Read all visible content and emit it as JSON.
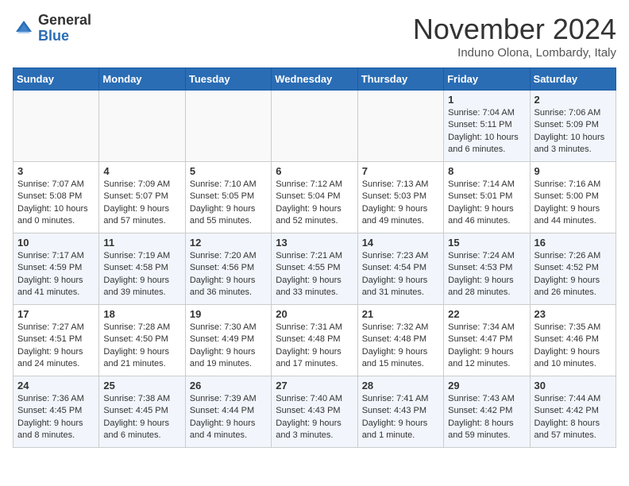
{
  "header": {
    "logo_general": "General",
    "logo_blue": "Blue",
    "month_title": "November 2024",
    "location": "Induno Olona, Lombardy, Italy"
  },
  "weekdays": [
    "Sunday",
    "Monday",
    "Tuesday",
    "Wednesday",
    "Thursday",
    "Friday",
    "Saturday"
  ],
  "weeks": [
    [
      {
        "day": "",
        "content": ""
      },
      {
        "day": "",
        "content": ""
      },
      {
        "day": "",
        "content": ""
      },
      {
        "day": "",
        "content": ""
      },
      {
        "day": "",
        "content": ""
      },
      {
        "day": "1",
        "content": "Sunrise: 7:04 AM\nSunset: 5:11 PM\nDaylight: 10 hours and 6 minutes."
      },
      {
        "day": "2",
        "content": "Sunrise: 7:06 AM\nSunset: 5:09 PM\nDaylight: 10 hours and 3 minutes."
      }
    ],
    [
      {
        "day": "3",
        "content": "Sunrise: 7:07 AM\nSunset: 5:08 PM\nDaylight: 10 hours and 0 minutes."
      },
      {
        "day": "4",
        "content": "Sunrise: 7:09 AM\nSunset: 5:07 PM\nDaylight: 9 hours and 57 minutes."
      },
      {
        "day": "5",
        "content": "Sunrise: 7:10 AM\nSunset: 5:05 PM\nDaylight: 9 hours and 55 minutes."
      },
      {
        "day": "6",
        "content": "Sunrise: 7:12 AM\nSunset: 5:04 PM\nDaylight: 9 hours and 52 minutes."
      },
      {
        "day": "7",
        "content": "Sunrise: 7:13 AM\nSunset: 5:03 PM\nDaylight: 9 hours and 49 minutes."
      },
      {
        "day": "8",
        "content": "Sunrise: 7:14 AM\nSunset: 5:01 PM\nDaylight: 9 hours and 46 minutes."
      },
      {
        "day": "9",
        "content": "Sunrise: 7:16 AM\nSunset: 5:00 PM\nDaylight: 9 hours and 44 minutes."
      }
    ],
    [
      {
        "day": "10",
        "content": "Sunrise: 7:17 AM\nSunset: 4:59 PM\nDaylight: 9 hours and 41 minutes."
      },
      {
        "day": "11",
        "content": "Sunrise: 7:19 AM\nSunset: 4:58 PM\nDaylight: 9 hours and 39 minutes."
      },
      {
        "day": "12",
        "content": "Sunrise: 7:20 AM\nSunset: 4:56 PM\nDaylight: 9 hours and 36 minutes."
      },
      {
        "day": "13",
        "content": "Sunrise: 7:21 AM\nSunset: 4:55 PM\nDaylight: 9 hours and 33 minutes."
      },
      {
        "day": "14",
        "content": "Sunrise: 7:23 AM\nSunset: 4:54 PM\nDaylight: 9 hours and 31 minutes."
      },
      {
        "day": "15",
        "content": "Sunrise: 7:24 AM\nSunset: 4:53 PM\nDaylight: 9 hours and 28 minutes."
      },
      {
        "day": "16",
        "content": "Sunrise: 7:26 AM\nSunset: 4:52 PM\nDaylight: 9 hours and 26 minutes."
      }
    ],
    [
      {
        "day": "17",
        "content": "Sunrise: 7:27 AM\nSunset: 4:51 PM\nDaylight: 9 hours and 24 minutes."
      },
      {
        "day": "18",
        "content": "Sunrise: 7:28 AM\nSunset: 4:50 PM\nDaylight: 9 hours and 21 minutes."
      },
      {
        "day": "19",
        "content": "Sunrise: 7:30 AM\nSunset: 4:49 PM\nDaylight: 9 hours and 19 minutes."
      },
      {
        "day": "20",
        "content": "Sunrise: 7:31 AM\nSunset: 4:48 PM\nDaylight: 9 hours and 17 minutes."
      },
      {
        "day": "21",
        "content": "Sunrise: 7:32 AM\nSunset: 4:48 PM\nDaylight: 9 hours and 15 minutes."
      },
      {
        "day": "22",
        "content": "Sunrise: 7:34 AM\nSunset: 4:47 PM\nDaylight: 9 hours and 12 minutes."
      },
      {
        "day": "23",
        "content": "Sunrise: 7:35 AM\nSunset: 4:46 PM\nDaylight: 9 hours and 10 minutes."
      }
    ],
    [
      {
        "day": "24",
        "content": "Sunrise: 7:36 AM\nSunset: 4:45 PM\nDaylight: 9 hours and 8 minutes."
      },
      {
        "day": "25",
        "content": "Sunrise: 7:38 AM\nSunset: 4:45 PM\nDaylight: 9 hours and 6 minutes."
      },
      {
        "day": "26",
        "content": "Sunrise: 7:39 AM\nSunset: 4:44 PM\nDaylight: 9 hours and 4 minutes."
      },
      {
        "day": "27",
        "content": "Sunrise: 7:40 AM\nSunset: 4:43 PM\nDaylight: 9 hours and 3 minutes."
      },
      {
        "day": "28",
        "content": "Sunrise: 7:41 AM\nSunset: 4:43 PM\nDaylight: 9 hours and 1 minute."
      },
      {
        "day": "29",
        "content": "Sunrise: 7:43 AM\nSunset: 4:42 PM\nDaylight: 8 hours and 59 minutes."
      },
      {
        "day": "30",
        "content": "Sunrise: 7:44 AM\nSunset: 4:42 PM\nDaylight: 8 hours and 57 minutes."
      }
    ]
  ]
}
